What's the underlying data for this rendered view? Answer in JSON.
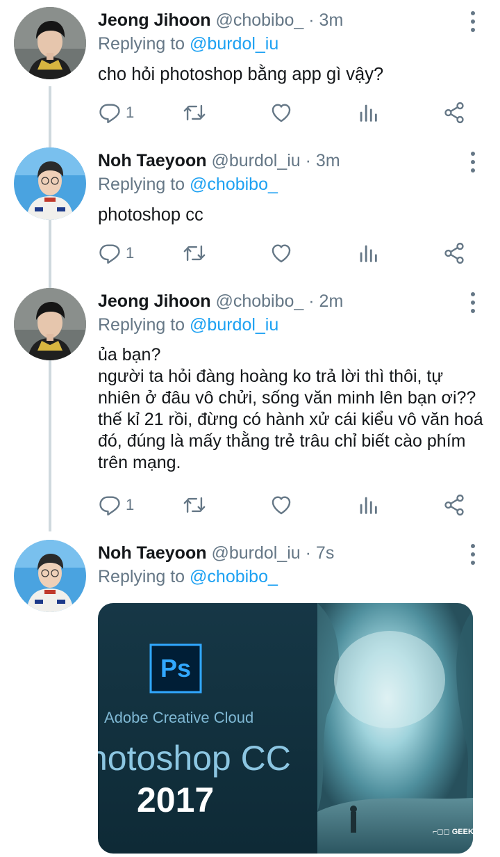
{
  "tweets": [
    {
      "name": "Jeong Jihoon",
      "handle": "@chobibo_",
      "time": "· 3m",
      "replying_prefix": "Replying to",
      "replying_to": "@burdol_iu",
      "text": "cho hỏi photoshop bằng app gì vậy?",
      "reply_count": "1",
      "avatar": "avatar-jeong"
    },
    {
      "name": "Noh Taeyoon",
      "handle": "@burdol_iu",
      "time": "· 3m",
      "replying_prefix": "Replying to",
      "replying_to": "@chobibo_",
      "text": "photoshop cc",
      "reply_count": "1",
      "avatar": "avatar-noh"
    },
    {
      "name": "Jeong Jihoon",
      "handle": "@chobibo_",
      "time": "· 2m",
      "replying_prefix": "Replying to",
      "replying_to": "@burdol_iu",
      "text": "ủa bạn?\nngười ta hỏi đàng hoàng ko trả lời thì thôi, tự nhiên ở đâu vô chửi, sống văn minh lên bạn ơi?? thế kỉ 21 rồi, đừng có hành xử cái kiểu vô văn hoá đó, đúng là mấy thằng trẻ trâu chỉ biết cào phím trên mạng.",
      "reply_count": "1",
      "avatar": "avatar-jeong"
    },
    {
      "name": "Noh Taeyoon",
      "handle": "@burdol_iu",
      "time": "· 7s",
      "replying_prefix": "Replying to",
      "replying_to": "@chobibo_",
      "avatar": "avatar-noh",
      "media": {
        "ps_logo": "Ps",
        "brand": "Adobe Creative Cloud",
        "product": "hotoshop CC",
        "year": "2017",
        "watermark": "GEEK"
      }
    }
  ],
  "icons": [
    "reply-icon",
    "retweet-icon",
    "like-icon",
    "analytics-icon",
    "share-icon",
    "more-icon"
  ],
  "colors": {
    "text": "#14171a",
    "secondary": "#657786",
    "link": "#1da1f2",
    "thread_line": "#cfd9de",
    "ps_blue": "#31a8ff"
  }
}
